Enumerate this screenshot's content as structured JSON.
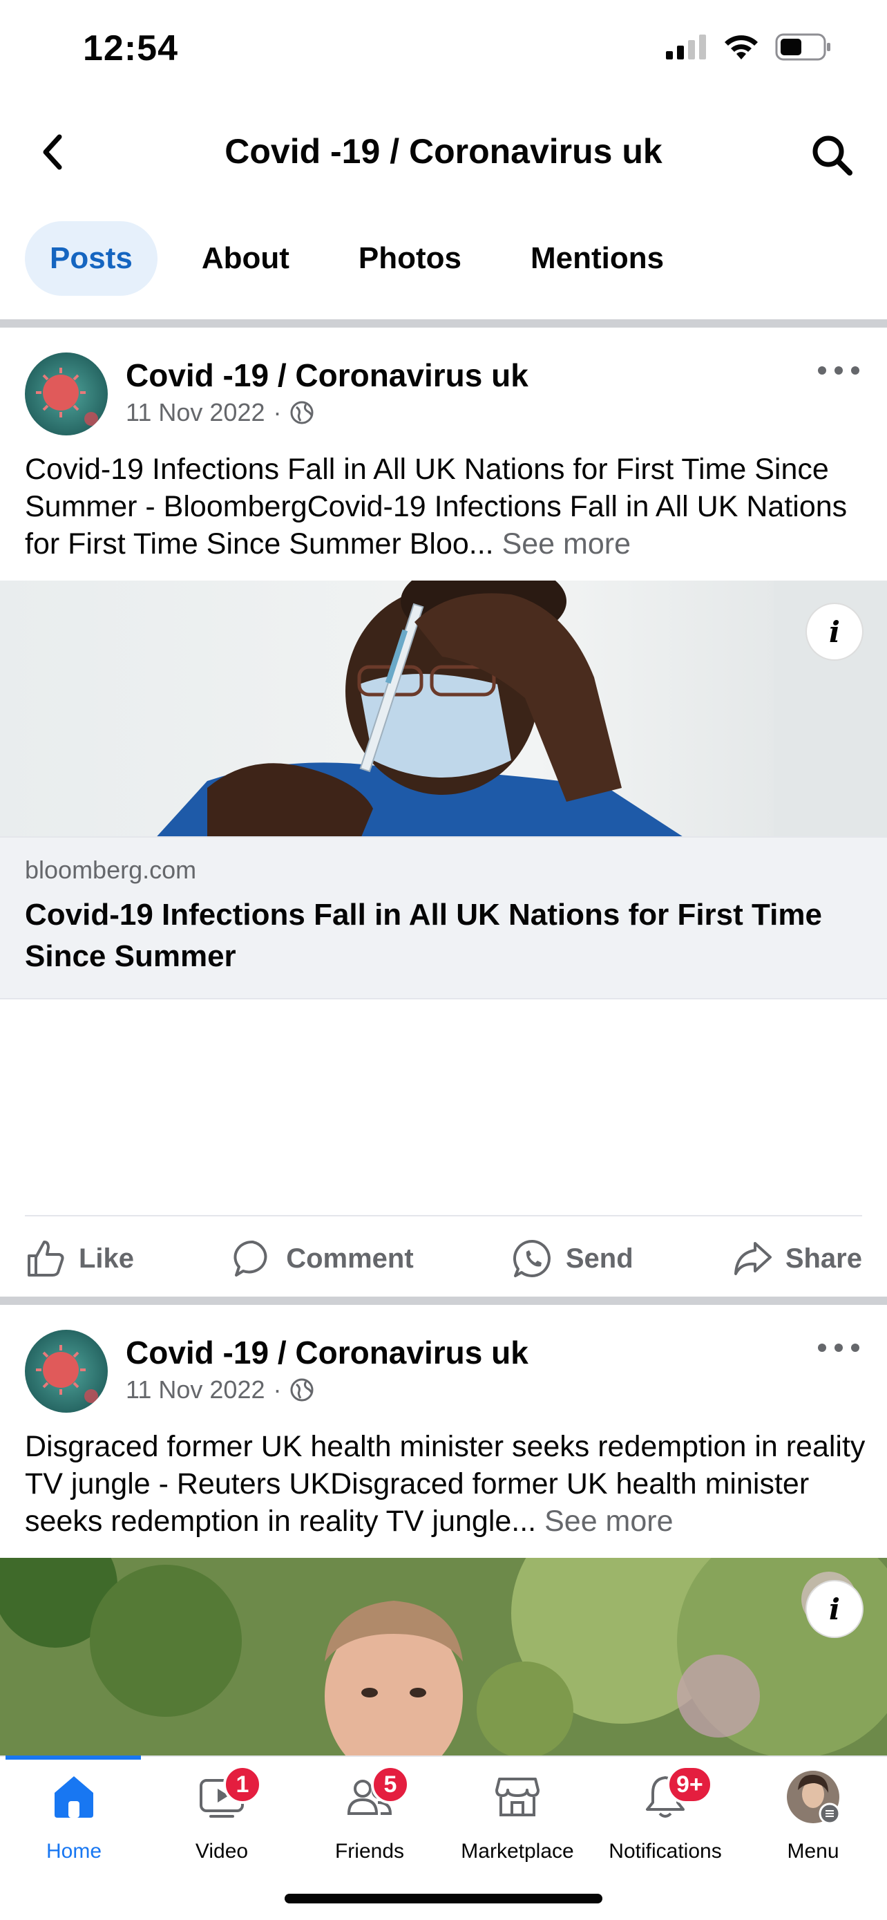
{
  "status_bar": {
    "time": "12:54"
  },
  "header": {
    "title": "Covid -19 / Coronavirus uk"
  },
  "tabs": [
    {
      "label": "Posts",
      "active": true
    },
    {
      "label": "About",
      "active": false
    },
    {
      "label": "Photos",
      "active": false
    },
    {
      "label": "Mentions",
      "active": false
    }
  ],
  "posts": [
    {
      "author": "Covid -19 / Coronavirus uk",
      "date": "11 Nov 2022",
      "dot": "·",
      "text": "Covid-19 Infections Fall in All UK Nations for First Time Since Summer - BloombergCovid-19 Infections Fall in All UK Nations for First Time Since Summer  Bloo...",
      "see_more": "See more",
      "info_label": "i",
      "link_domain": "bloomberg.com",
      "link_title": "Covid-19 Infections Fall in All UK Nations for First Time Since Summer"
    },
    {
      "author": "Covid -19 / Coronavirus uk",
      "date": "11 Nov 2022",
      "dot": "·",
      "text": "Disgraced former UK health minister seeks redemption in reality TV jungle - Reuters UKDisgraced former UK health minister seeks redemption in reality TV jungle...",
      "see_more": "See more",
      "info_label": "i"
    }
  ],
  "actions": {
    "like": "Like",
    "comment": "Comment",
    "send": "Send",
    "share": "Share"
  },
  "bottom_nav": [
    {
      "label": "Home",
      "icon": "home-icon",
      "active": true
    },
    {
      "label": "Video",
      "icon": "video-icon",
      "badge": "1"
    },
    {
      "label": "Friends",
      "icon": "friends-icon",
      "badge": "5"
    },
    {
      "label": "Marketplace",
      "icon": "marketplace-icon"
    },
    {
      "label": "Notifications",
      "icon": "bell-icon",
      "badge": "9+"
    },
    {
      "label": "Menu",
      "icon": "profile-avatar"
    }
  ],
  "colors": {
    "accent": "#1877f2",
    "badge": "#e41e3f",
    "tab_active_bg": "#e6f0fb"
  }
}
